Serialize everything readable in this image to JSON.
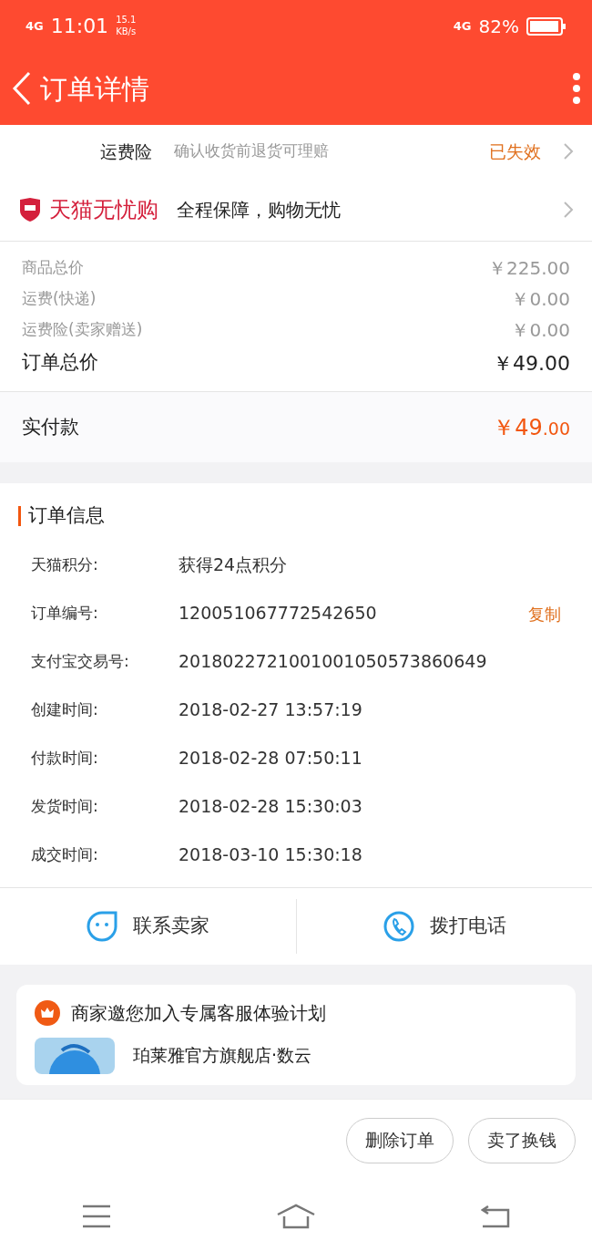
{
  "status_bar": {
    "network": "4G",
    "time": "11:01",
    "speed": "15.1 KB/s",
    "network_right": "4G",
    "battery": "82%"
  },
  "header": {
    "title": "订单详情"
  },
  "insurance": {
    "label": "运费险",
    "description": "确认收货前退货可理赔",
    "status": "已失效"
  },
  "guarantee": {
    "brand": "天猫无忧购",
    "text": "全程保障，购物无忧"
  },
  "prices": [
    {
      "label": "商品总价",
      "value": "￥225.00",
      "kind": "minor"
    },
    {
      "label": "运费(快递)",
      "value": "￥0.00",
      "kind": "minor"
    },
    {
      "label": "运费险(卖家赠送)",
      "value": "￥0.00",
      "kind": "minor"
    },
    {
      "label": "订单总价",
      "value": "￥49.00",
      "kind": "major"
    }
  ],
  "paid": {
    "label": "实付款",
    "integer": "￥49",
    "decimal": ".00"
  },
  "order_info": {
    "title": "订单信息",
    "rows": [
      {
        "label": "天猫积分:",
        "value": "获得24点积分"
      },
      {
        "label": "订单编号:",
        "value": "120051067772542650",
        "action": "复制"
      },
      {
        "label": "支付宝交易号:",
        "value": "2018022721001001050573860649"
      },
      {
        "label": "创建时间:",
        "value": "2018-02-27 13:57:19"
      },
      {
        "label": "付款时间:",
        "value": "2018-02-28 07:50:11"
      },
      {
        "label": "发货时间:",
        "value": "2018-02-28 15:30:03"
      },
      {
        "label": "成交时间:",
        "value": "2018-03-10 15:30:18"
      }
    ]
  },
  "contact": [
    {
      "label": "联系卖家",
      "kind": "chat"
    },
    {
      "label": "拨打电话",
      "kind": "phone"
    }
  ],
  "invite": {
    "title": "商家邀您加入专属客服体验计划",
    "store": "珀莱雅官方旗舰店·数云"
  },
  "actions": [
    "删除订单",
    "卖了换钱"
  ]
}
